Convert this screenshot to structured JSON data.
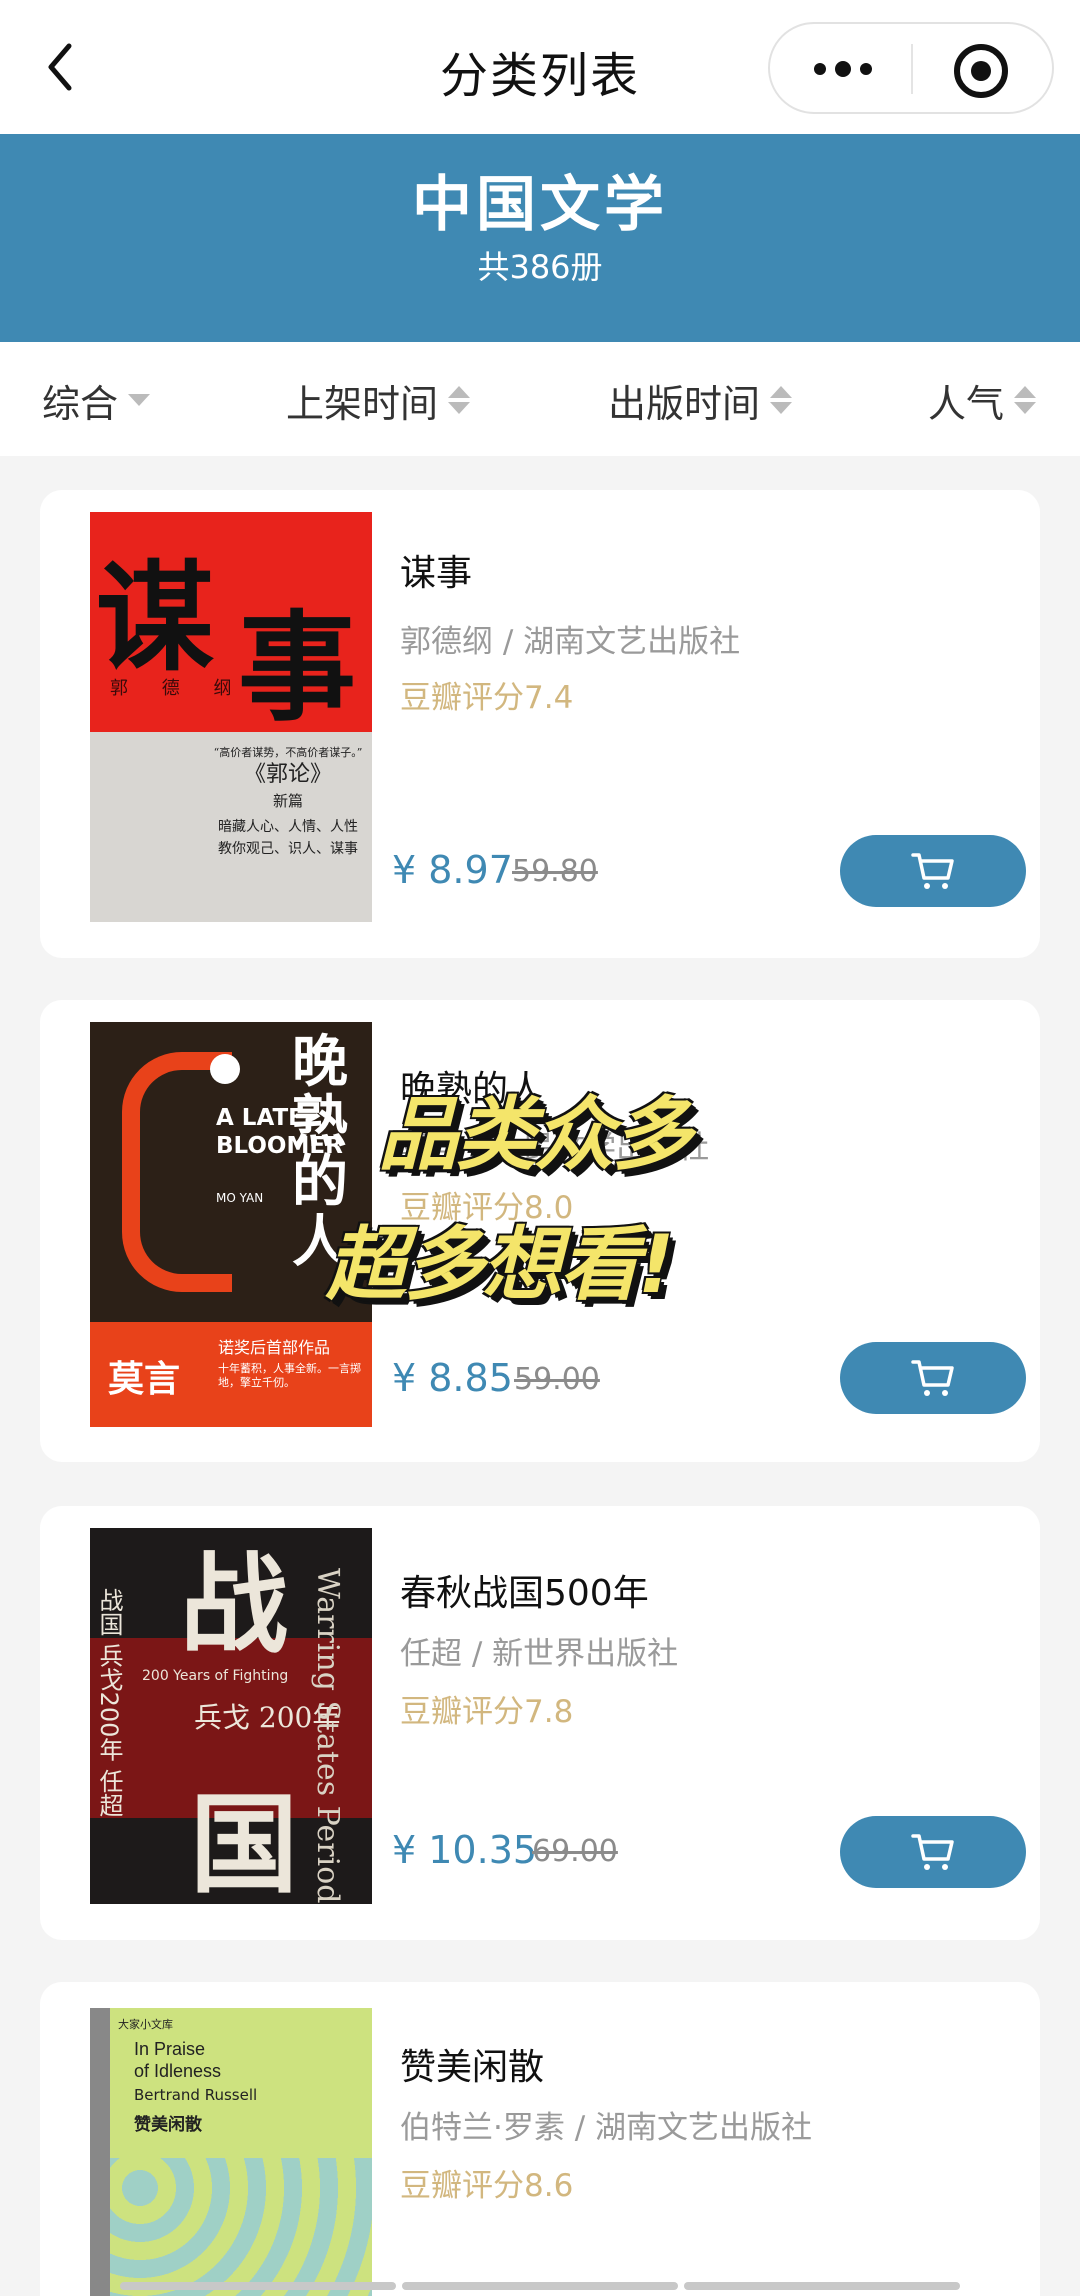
{
  "nav": {
    "title": "分类列表",
    "back_icon": "chevron-left-icon",
    "more_icon": "more-dots-icon",
    "target_icon": "target-icon"
  },
  "banner": {
    "title": "中国文学",
    "count": "共386册",
    "background": "#3f89b3"
  },
  "sort": [
    "综合",
    "上架时间",
    "出版时间",
    "人气"
  ],
  "promo": {
    "line1": "品类众多",
    "line2": "超多想看!"
  },
  "books": [
    {
      "title": "谋事",
      "meta": "郭德纲 / 湖南文艺出版社",
      "rating": "豆瓣评分7.4",
      "price": "¥ 8.97",
      "original": "59.80",
      "cover": {
        "big1": "谋",
        "big2": "事",
        "author": "郭 德 纲",
        "quote": "“高价者谋势，不高价者谋子。”",
        "book": "《郭论》",
        "sub": "新篇",
        "text1": "暗藏人心、人情、人性",
        "text2": "教你观己、识人、谋事"
      }
    },
    {
      "title": "晚熟的人",
      "meta": "莫言 / 人民文学出版社",
      "rating": "豆瓣评分8.0",
      "price": "¥ 8.85",
      "original": "59.00",
      "cover": {
        "vert": "晚熟的人",
        "en": "A LATE BLOOMER",
        "en_author": "MO YAN",
        "author": "莫言",
        "tag": "诺奖后首部作品",
        "tag2": "十年蓄积，人事全新。一言掷地，擎立千仞。"
      }
    },
    {
      "title": "春秋战国500年",
      "meta": "任超 / 新世界出版社",
      "rating": "豆瓣评分7.8",
      "price": "¥ 10.35",
      "original": "69.00",
      "cover": {
        "big1": "战",
        "big2": "国",
        "sub": "兵戈 200年",
        "en": "200 Years of Fighting",
        "side": "Warring States Period",
        "author": "战国 兵戈200年 任超"
      }
    },
    {
      "title": "赞美闲散",
      "meta": "伯特兰·罗素 / 湖南文艺出版社",
      "rating": "豆瓣评分8.6",
      "cover": {
        "lib": "大家小文库",
        "en1": "In Praise",
        "en2": "of Idleness",
        "author_en": "Bertrand Russell",
        "cn": "赞美闲散"
      }
    }
  ]
}
